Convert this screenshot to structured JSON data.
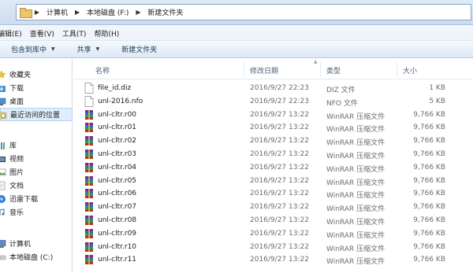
{
  "address": {
    "crumbs": [
      "计算机",
      "本地磁盘 (F:)",
      "新建文件夹"
    ]
  },
  "menu": [
    "编辑(E)",
    "查看(V)",
    "工具(T)",
    "帮助(H)"
  ],
  "commands": [
    {
      "label": "包含到库中",
      "dropdown": true
    },
    {
      "label": "共享",
      "dropdown": true
    },
    {
      "label": "新建文件夹",
      "dropdown": false
    }
  ],
  "nav": {
    "items": [
      {
        "label": "收藏夹",
        "icon": "star-icon",
        "kind": "header"
      },
      {
        "label": "下载",
        "icon": "download-folder-icon",
        "kind": "item"
      },
      {
        "label": "桌面",
        "icon": "desktop-icon",
        "kind": "item"
      },
      {
        "label": "最近访问的位置",
        "icon": "recent-places-icon",
        "kind": "item",
        "selected": true
      },
      {
        "label": "库",
        "icon": "library-icon",
        "kind": "header"
      },
      {
        "label": "视频",
        "icon": "video-library-icon",
        "kind": "item"
      },
      {
        "label": "图片",
        "icon": "pictures-library-icon",
        "kind": "item"
      },
      {
        "label": "文档",
        "icon": "documents-library-icon",
        "kind": "item"
      },
      {
        "label": "迅雷下载",
        "icon": "thunder-download-icon",
        "kind": "item"
      },
      {
        "label": "音乐",
        "icon": "music-library-icon",
        "kind": "item"
      },
      {
        "label": "计算机",
        "icon": "computer-icon",
        "kind": "header"
      },
      {
        "label": "本地磁盘 (C:)",
        "icon": "drive-icon",
        "kind": "item"
      }
    ]
  },
  "columns": {
    "name": "名称",
    "date": "修改日期",
    "type": "类型",
    "size": "大小"
  },
  "files": [
    {
      "name": "file_id.diz",
      "date": "2016/9/27 22:23",
      "type": "DIZ 文件",
      "size": "1 KB",
      "icon": "text-file-icon"
    },
    {
      "name": "unl-2016.nfo",
      "date": "2016/9/27 22:23",
      "type": "NFO 文件",
      "size": "5 KB",
      "icon": "text-file-icon"
    },
    {
      "name": "unl-cltr.r00",
      "date": "2016/9/27 13:22",
      "type": "WinRAR 压缩文件",
      "size": "9,766 KB",
      "icon": "winrar-icon"
    },
    {
      "name": "unl-cltr.r01",
      "date": "2016/9/27 13:22",
      "type": "WinRAR 压缩文件",
      "size": "9,766 KB",
      "icon": "winrar-icon"
    },
    {
      "name": "unl-cltr.r02",
      "date": "2016/9/27 13:22",
      "type": "WinRAR 压缩文件",
      "size": "9,766 KB",
      "icon": "winrar-icon"
    },
    {
      "name": "unl-cltr.r03",
      "date": "2016/9/27 13:22",
      "type": "WinRAR 压缩文件",
      "size": "9,766 KB",
      "icon": "winrar-icon"
    },
    {
      "name": "unl-cltr.r04",
      "date": "2016/9/27 13:22",
      "type": "WinRAR 压缩文件",
      "size": "9,766 KB",
      "icon": "winrar-icon"
    },
    {
      "name": "unl-cltr.r05",
      "date": "2016/9/27 13:22",
      "type": "WinRAR 压缩文件",
      "size": "9,766 KB",
      "icon": "winrar-icon"
    },
    {
      "name": "unl-cltr.r06",
      "date": "2016/9/27 13:22",
      "type": "WinRAR 压缩文件",
      "size": "9,766 KB",
      "icon": "winrar-icon"
    },
    {
      "name": "unl-cltr.r07",
      "date": "2016/9/27 13:22",
      "type": "WinRAR 压缩文件",
      "size": "9,766 KB",
      "icon": "winrar-icon"
    },
    {
      "name": "unl-cltr.r08",
      "date": "2016/9/27 13:22",
      "type": "WinRAR 压缩文件",
      "size": "9,766 KB",
      "icon": "winrar-icon"
    },
    {
      "name": "unl-cltr.r09",
      "date": "2016/9/27 13:22",
      "type": "WinRAR 压缩文件",
      "size": "9,766 KB",
      "icon": "winrar-icon"
    },
    {
      "name": "unl-cltr.r10",
      "date": "2016/9/27 13:22",
      "type": "WinRAR 压缩文件",
      "size": "9,766 KB",
      "icon": "winrar-icon"
    },
    {
      "name": "unl-cltr.r11",
      "date": "2016/9/27 13:22",
      "type": "WinRAR 压缩文件",
      "size": "9,766 KB",
      "icon": "winrar-icon"
    }
  ]
}
